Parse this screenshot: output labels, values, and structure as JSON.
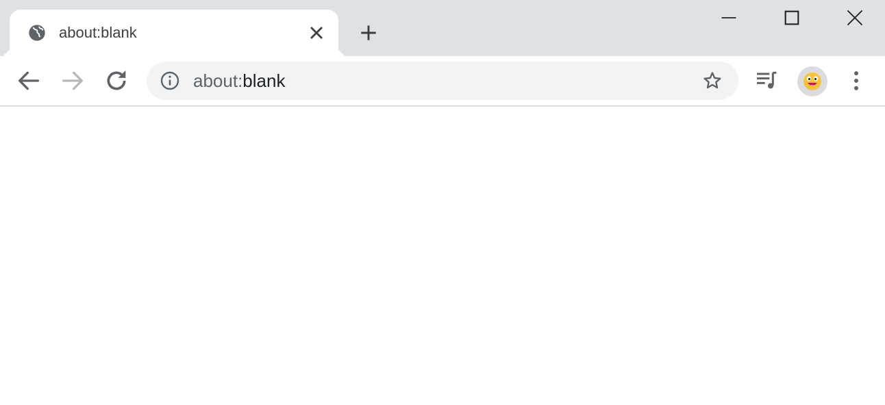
{
  "tab": {
    "title": "about:blank",
    "favicon": "globe-icon"
  },
  "address_bar": {
    "url_scheme": "about:",
    "url_rest": "blank"
  },
  "icons": {
    "tab_close": "close-icon",
    "new_tab": "plus-icon",
    "minimize": "minimize-icon",
    "maximize": "maximize-icon",
    "window_close": "close-icon",
    "back": "back-arrow-icon",
    "forward": "forward-arrow-icon",
    "reload": "reload-icon",
    "site_info": "info-icon",
    "bookmark": "star-icon",
    "media": "media-queue-icon",
    "profile": "avatar",
    "menu": "kebab-menu-icon"
  },
  "colors": {
    "tabstrip_bg": "#dee1e6",
    "omnibox_bg": "#f1f3f4",
    "icon_color": "#5f6368",
    "text_color": "#202124"
  }
}
